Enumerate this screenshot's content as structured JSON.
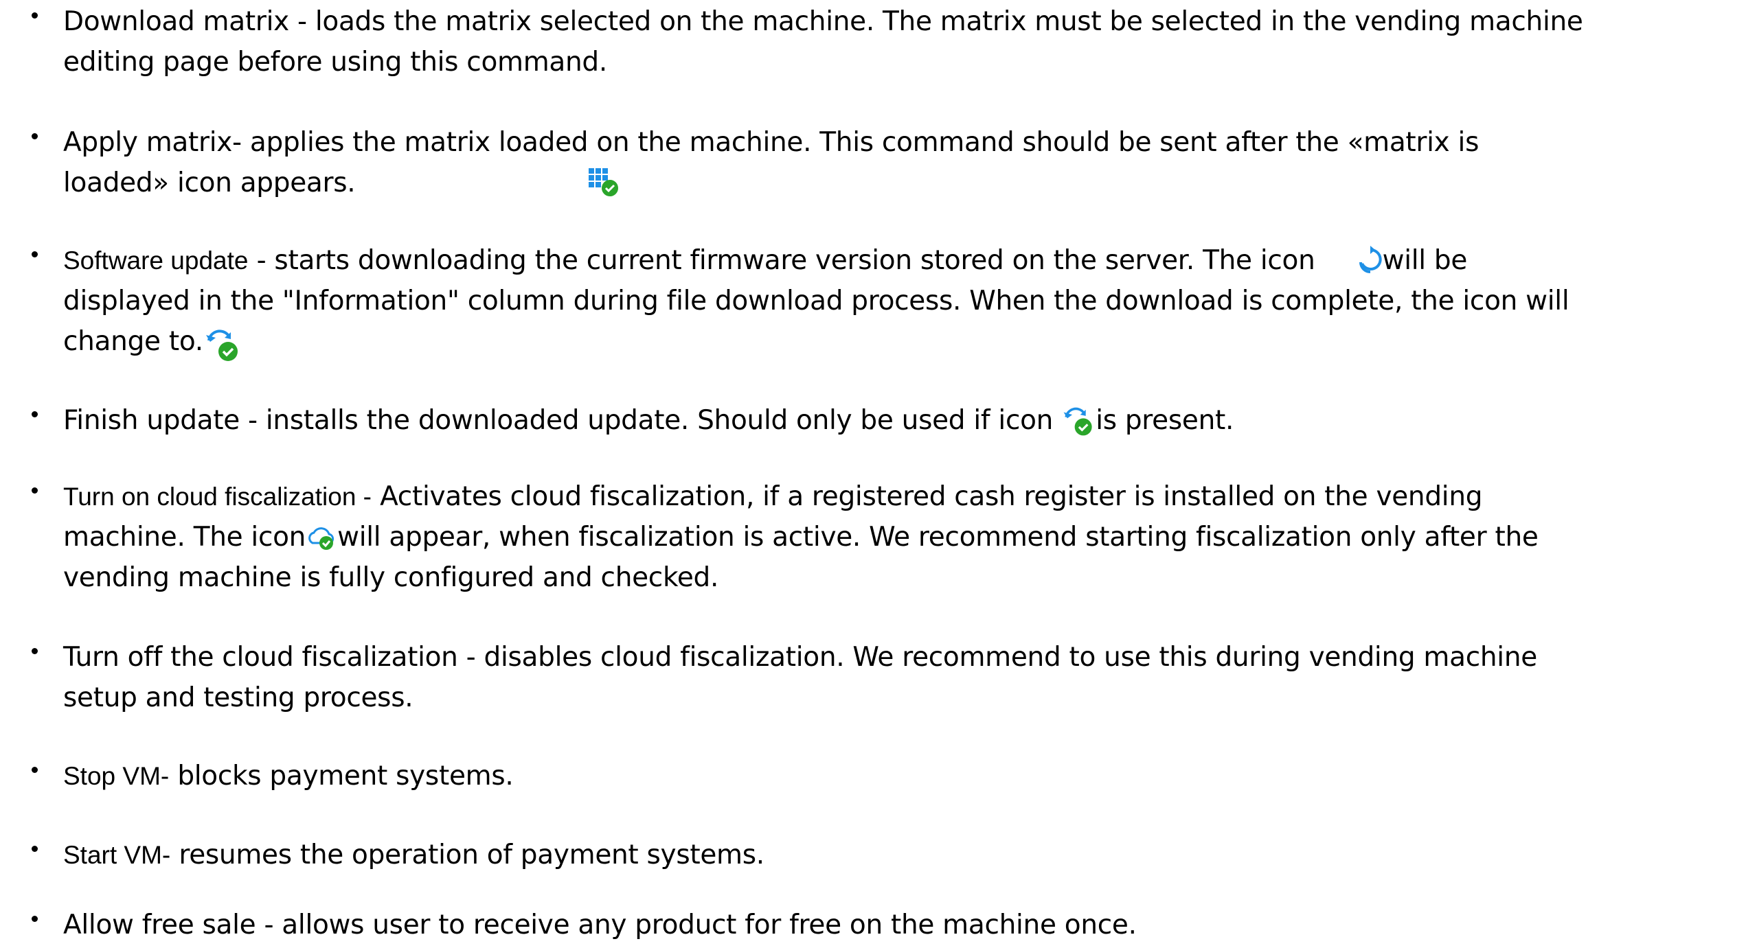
{
  "items": [
    {
      "name": "Download matrix",
      "line1": "Download matrix - loads the matrix selected on the machine. The matrix must be selected in the vending machine",
      "line2": "editing page before using this command."
    },
    {
      "name": "Apply matrix",
      "line1": "Apply matrix- applies the matrix loaded on the machine. This command should be sent after the «matrix is",
      "line2": "loaded» icon appears.",
      "icon": "matrix-loaded-icon"
    },
    {
      "name": "Software update",
      "label": "Software update",
      "line1_rest": " - starts downloading the current firmware version stored on the server. The icon",
      "line1_tail": "will be",
      "line2": "displayed in the \"Information\" column during file download process. When the download is complete, the icon will",
      "line3": "change to.",
      "icons": [
        "sync-downloading-icon",
        "sync-complete-icon"
      ]
    },
    {
      "name": "Finish update",
      "line1_a": "Finish update - installs the downloaded update. Should only be used if icon",
      "line1_b": "is present.",
      "icon": "sync-complete-icon"
    },
    {
      "name": "Turn on cloud fiscalization",
      "label": "Turn on cloud fiscalization -",
      "line1_rest": " Activates cloud fiscalization, if a registered cash register is installed on the vending",
      "line2_a": "machine. The icon",
      "line2_b": "will appear, when fiscalization is active. We recommend starting fiscalization only after the",
      "line3": "vending machine is fully configured and checked.",
      "icon": "cloud-fiscalization-icon"
    },
    {
      "name": "Turn off the cloud fiscalization",
      "line1": "Turn off the cloud fiscalization - disables cloud fiscalization. We recommend to use this during vending machine",
      "line2": "setup and testing process."
    },
    {
      "name": "Stop VM",
      "label": "Stop VM-",
      "rest": " blocks payment systems."
    },
    {
      "name": "Start VM",
      "label": "Start VM-",
      "rest": " resumes the operation of payment systems."
    },
    {
      "name": "Allow free sale",
      "line1": "Allow free sale - allows user to receive any product for free on the machine once."
    }
  ],
  "colors": {
    "text": "#000000",
    "icon_blue": "#1e90e6",
    "icon_green": "#2aa52a"
  }
}
